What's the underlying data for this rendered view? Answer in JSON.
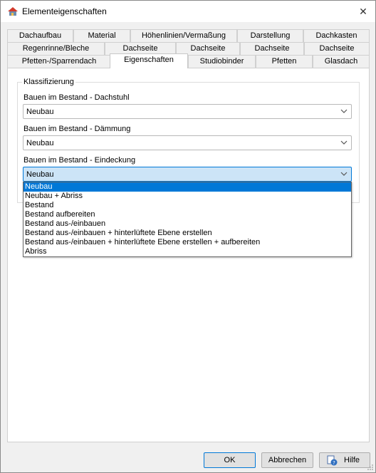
{
  "window": {
    "title": "Elementeigenschaften"
  },
  "tabs": {
    "row1": [
      "Dachaufbau",
      "Material",
      "Höhenlinien/Vermaßung",
      "Darstellung",
      "Dachkasten"
    ],
    "row2": [
      "Regenrinne/Bleche",
      "Dachseite",
      "Dachseite",
      "Dachseite",
      "Dachseite"
    ],
    "row3": [
      "Pfetten-/Sparrendach",
      "Eigenschaften",
      "Studiobinder",
      "Pfetten",
      "Glasdach"
    ],
    "active": "Eigenschaften"
  },
  "group": {
    "label": "Klassifizierung"
  },
  "fields": [
    {
      "label": "Bauen im Bestand - Dachstuhl",
      "value": "Neubau"
    },
    {
      "label": "Bauen im Bestand - Dämmung",
      "value": "Neubau"
    },
    {
      "label": "Bauen im Bestand - Eindeckung",
      "value": "Neubau"
    }
  ],
  "dropdown": {
    "options": [
      "Neubau",
      "Neubau + Abriss",
      "Bestand",
      "Bestand aufbereiten",
      "Bestand aus-/einbauen",
      "Bestand aus-/einbauen + hinterlüftete Ebene erstellen",
      "Bestand aus-/einbauen + hinterlüftete Ebene erstellen + aufbereiten",
      "Abriss"
    ],
    "selected_index": 0
  },
  "buttons": {
    "ok": "OK",
    "cancel": "Abbrechen",
    "help": "Hilfe"
  },
  "colors": {
    "accent": "#0078d7",
    "selection": "#cce4f7"
  }
}
